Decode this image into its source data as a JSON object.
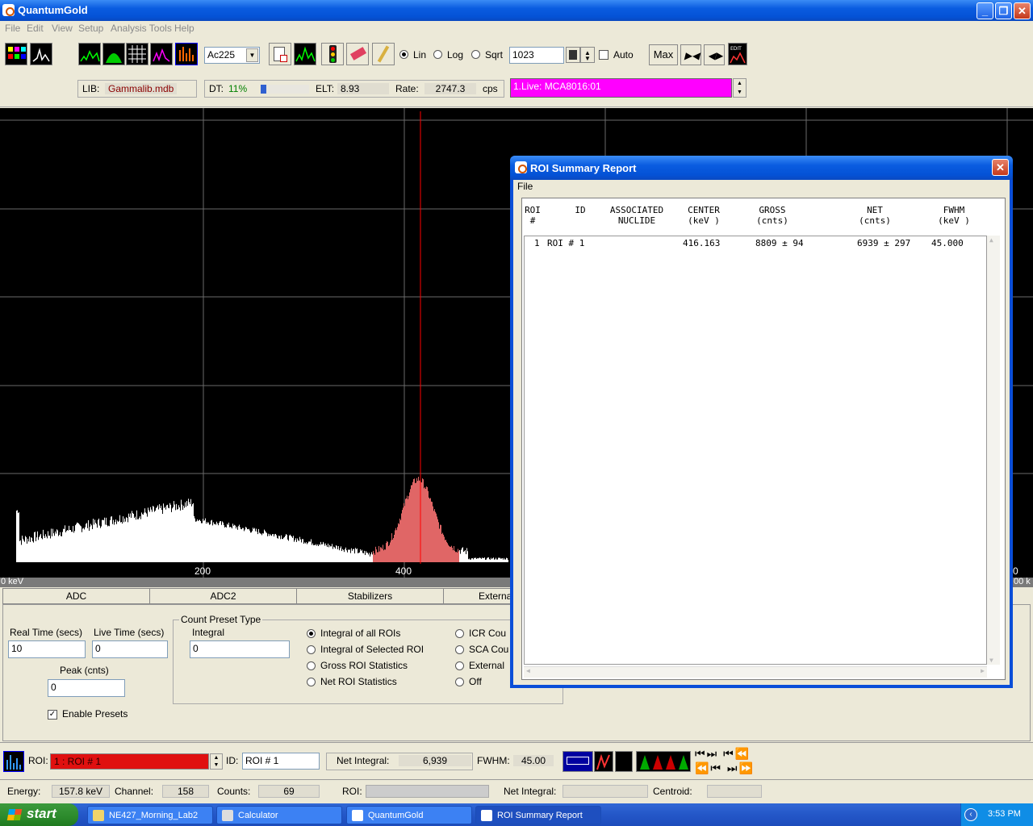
{
  "app": {
    "title": "QuantumGold"
  },
  "window_buttons": {
    "minimize": "_",
    "maximize": "❐",
    "close": "✕"
  },
  "menu": [
    "File",
    "Edit",
    "View",
    "Setup",
    "Analysis Tools",
    "Help"
  ],
  "toolbar": {
    "nuclide_select": "Ac225",
    "scale_lin": "Lin",
    "scale_log": "Log",
    "scale_sqrt": "Sqrt",
    "scale_selected": "Lin",
    "vertical_full_scale": "1023",
    "auto_label": "Auto",
    "max_label": "Max",
    "lib_label": "LIB:",
    "lib_value": "Gammalib.mdb",
    "dt_label": "DT:",
    "dt_value": "11%",
    "dt_fraction": 0.11,
    "elt_label": "ELT:",
    "elt_value": "8.93",
    "rate_label": "Rate:",
    "rate_value": "2747.3",
    "rate_unit": "cps",
    "detector_value": "1.Live: MCA8016:01",
    "colors": {
      "detector_bg": "#ff00ff",
      "lib_text": "#8b0000",
      "dt_text": "#008000"
    }
  },
  "spectrum": {
    "axis_start": "0 keV",
    "x_ticks": [
      "200",
      "400"
    ],
    "right_tick": "0",
    "right_edge_partial": "00 k",
    "colors": {
      "background": "#000000",
      "counts": "#ffffff",
      "roi": "#e06666",
      "cursor": "#ff0000",
      "grid": "#6a6a6a"
    }
  },
  "tabs": [
    "ADC",
    "ADC2",
    "Stabilizers",
    "Externa"
  ],
  "presets": {
    "real_time_label": "Real Time (secs)",
    "real_time_value": "10",
    "live_time_label": "Live Time (secs)",
    "live_time_value": "0",
    "peak_label": "Peak (cnts)",
    "peak_value": "0",
    "enable_presets_label": "Enable Presets",
    "enable_presets_checked": true,
    "count_preset_type_label": "Count Preset Type",
    "integral_label": "Integral",
    "integral_value": "0",
    "options_col1": [
      "Integral of all ROIs",
      "Integral of Selected ROI",
      "Gross ROI Statistics",
      "Net ROI Statistics"
    ],
    "options_col2": [
      "ICR Cou",
      "SCA Cou",
      "External",
      "Off"
    ],
    "selected_option": "Integral of all ROIs"
  },
  "roi_bar": {
    "roi_label": "ROI:",
    "roi_value": "1 : ROI # 1",
    "id_label": "ID:",
    "id_value": "ROI # 1",
    "net_integral_label": "Net Integral:",
    "net_integral_value": "6,939",
    "fwhm_label": "FWHM:",
    "fwhm_value": "45.00"
  },
  "status_bar": {
    "energy_label": "Energy:",
    "energy_value": "157.8 keV",
    "channel_label": "Channel:",
    "channel_value": "158",
    "counts_label": "Counts:",
    "counts_value": "69",
    "roi_label": "ROI:",
    "net_integral_label": "Net Integral:",
    "centroid_label": "Centroid:"
  },
  "dialog": {
    "title": "ROI Summary Report",
    "menu_file": "File",
    "headers": {
      "roi": "ROI\n#",
      "id": "ID",
      "nuclide": "ASSOCIATED\nNUCLIDE",
      "center": "CENTER\n(keV )",
      "gross": "GROSS\n(cnts)",
      "net": "NET\n(cnts)",
      "fwhm": "FWHM\n(keV )"
    },
    "rows": [
      {
        "roi": "1",
        "id": "ROI # 1",
        "nuclide": "",
        "center": "416.163",
        "gross": "8809 ± 94",
        "net": "6939 ± 297",
        "fwhm": "45.000"
      }
    ]
  },
  "taskbar": {
    "start_label": "start",
    "tasks": [
      "NE427_Morning_Lab2",
      "Calculator",
      "QuantumGold",
      "ROI Summary Report"
    ],
    "active_task": "ROI Summary Report",
    "clock": "3:53 PM"
  }
}
